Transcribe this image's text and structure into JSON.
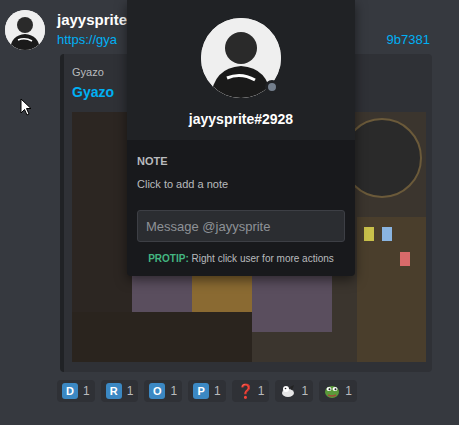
{
  "message": {
    "author": "jayysprite",
    "link_start": "https://gya",
    "link_end": "9b7381"
  },
  "embed": {
    "provider": "Gyazo",
    "title": "Gyazo"
  },
  "reactions": [
    {
      "kind": "letter",
      "emoji": "D",
      "count": "1"
    },
    {
      "kind": "letter",
      "emoji": "R",
      "count": "1"
    },
    {
      "kind": "letter",
      "emoji": "O",
      "count": "1"
    },
    {
      "kind": "letter",
      "emoji": "P",
      "count": "1"
    },
    {
      "kind": "glyph",
      "emoji": "❓",
      "count": "1"
    },
    {
      "kind": "sticker",
      "emoji": "",
      "count": "1"
    },
    {
      "kind": "pepe",
      "emoji": "",
      "count": "1"
    }
  ],
  "popout": {
    "username_tag": "jayysprite#2928",
    "status": "offline",
    "note_label": "NOTE",
    "note_placeholder": "Click to add a note",
    "message_placeholder": "Message @jayysprite",
    "protip_label": "PROTIP:",
    "protip_text": "Right click user for more actions"
  }
}
